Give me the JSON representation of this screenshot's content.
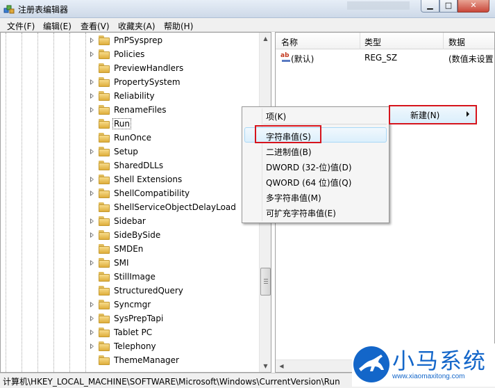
{
  "window": {
    "title": "注册表编辑器"
  },
  "menubar": [
    "文件(F)",
    "编辑(E)",
    "查看(V)",
    "收藏夹(A)",
    "帮助(H)"
  ],
  "tree": {
    "items": [
      {
        "label": "PnPSysprep",
        "expandable": true
      },
      {
        "label": "Policies",
        "expandable": true
      },
      {
        "label": "PreviewHandlers",
        "expandable": false
      },
      {
        "label": "PropertySystem",
        "expandable": true
      },
      {
        "label": "Reliability",
        "expandable": true
      },
      {
        "label": "RenameFiles",
        "expandable": true
      },
      {
        "label": "Run",
        "expandable": false,
        "selected": true
      },
      {
        "label": "RunOnce",
        "expandable": false
      },
      {
        "label": "Setup",
        "expandable": true
      },
      {
        "label": "SharedDLLs",
        "expandable": false
      },
      {
        "label": "Shell Extensions",
        "expandable": true
      },
      {
        "label": "ShellCompatibility",
        "expandable": true
      },
      {
        "label": "ShellServiceObjectDelayLoad",
        "expandable": false
      },
      {
        "label": "Sidebar",
        "expandable": true
      },
      {
        "label": "SideBySide",
        "expandable": true
      },
      {
        "label": "SMDEn",
        "expandable": false
      },
      {
        "label": "SMI",
        "expandable": true
      },
      {
        "label": "StillImage",
        "expandable": false
      },
      {
        "label": "StructuredQuery",
        "expandable": false
      },
      {
        "label": "Syncmgr",
        "expandable": true
      },
      {
        "label": "SysPrepTapi",
        "expandable": true
      },
      {
        "label": "Tablet PC",
        "expandable": true
      },
      {
        "label": "Telephony",
        "expandable": true
      },
      {
        "label": "ThemeManager",
        "expandable": false
      }
    ]
  },
  "list": {
    "columns": [
      "名称",
      "类型",
      "数据"
    ],
    "rows": [
      {
        "name": "(默认)",
        "type": "REG_SZ",
        "data": "(数值未设置"
      }
    ]
  },
  "context_menu": {
    "parent": "新建(N)",
    "items": [
      "项(K)",
      "字符串值(S)",
      "二进制值(B)",
      "DWORD (32-位)值(D)",
      "QWORD (64 位)值(Q)",
      "多字符串值(M)",
      "可扩充字符串值(E)"
    ],
    "highlighted": "字符串值(S)"
  },
  "statusbar": {
    "path": "计算机\\HKEY_LOCAL_MACHINE\\SOFTWARE\\Microsoft\\Windows\\CurrentVersion\\Run"
  },
  "watermark": {
    "brand": "小马系统",
    "url": "www.xiaomaxitong.com"
  },
  "colors": {
    "highlight_border": "#d6141c",
    "brand_blue": "#1366c9"
  }
}
